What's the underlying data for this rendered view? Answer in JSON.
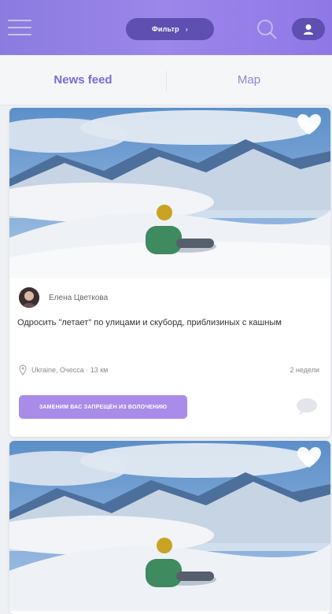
{
  "header": {
    "menu_icon": "hamburger-icon",
    "filter_label": "Фильтр",
    "filter_chevron": "›",
    "search_icon": "search-icon",
    "profile_icon": "profile-icon"
  },
  "tabs": [
    {
      "label": "News feed",
      "active": true
    },
    {
      "label": "Мap",
      "active": false
    }
  ],
  "posts": [
    {
      "author": "Елена Цветкова",
      "description": "Одросить \"летает\" по улицами и скуборд, приблизиных с кашным",
      "location": "Ukraine, Очесса · 13 км",
      "time": "2 недели",
      "tag_label": "ЗАМЕНИМ ВАС ЗАПРЕЩЁН ИЗ ВОЛОЧЕНИЮ",
      "heart_icon": "heart-icon",
      "comment_icon": "comment-icon",
      "location_icon": "map-pin-icon"
    },
    {
      "heart_icon": "heart-icon"
    }
  ],
  "colors": {
    "header_gradient_start": "#8b7be0",
    "header_gradient_end": "#8f78e6",
    "pill": "#5e4fb0",
    "accent": "#7b68d6",
    "tag_bg": "#a98bea"
  }
}
